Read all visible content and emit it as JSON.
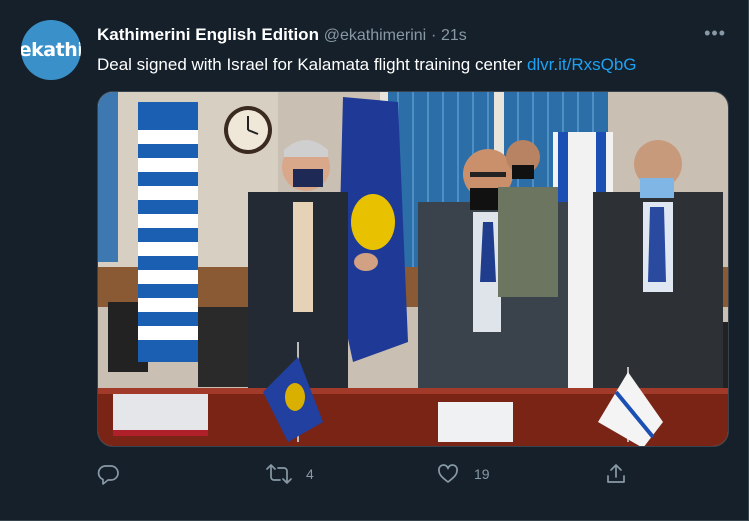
{
  "tweet": {
    "avatar_text": "ekathi",
    "display_name": "Kathimerini English Edition",
    "handle": "@ekathimerini",
    "separator": "·",
    "time": "21s",
    "more_label": "•••",
    "text": "Deal signed with Israel for Kalamata flight training center ",
    "link": "dlvr.it/RxsQbG"
  },
  "actions": {
    "reply_count": "",
    "retweet_count": "4",
    "like_count": "19"
  },
  "colors": {
    "background": "#15202b",
    "primary_text": "#ffffff",
    "secondary_text": "#8899a6",
    "link": "#1da1f2",
    "avatar": "#3a90c8"
  },
  "icons": [
    "reply-icon",
    "retweet-icon",
    "like-icon",
    "share-icon",
    "more-icon"
  ]
}
